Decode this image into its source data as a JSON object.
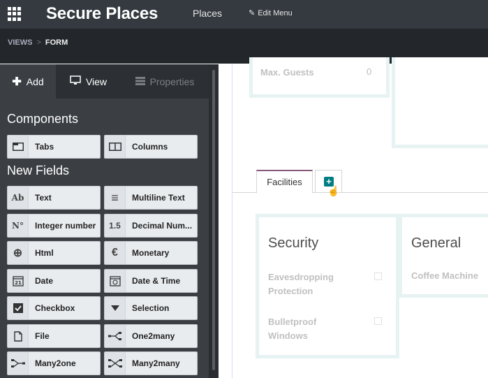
{
  "topbar": {
    "app_title": "Secure Places",
    "menu_places": "Places",
    "edit_menu": "Edit Menu"
  },
  "breadcrumb": {
    "views": "VIEWS",
    "sep": ">",
    "form": "FORM"
  },
  "sidebar": {
    "tabs": {
      "add": "Add",
      "view": "View",
      "properties": "Properties"
    },
    "components_title": "Components",
    "new_fields_title": "New Fields",
    "components": [
      {
        "label": "Tabs",
        "icon": "tabs-icon"
      },
      {
        "label": "Columns",
        "icon": "columns-icon"
      }
    ],
    "fields": [
      {
        "label": "Text",
        "glyph": "Ab"
      },
      {
        "label": "Multiline Text",
        "glyph": "≡"
      },
      {
        "label": "Integer number",
        "glyph": "N°"
      },
      {
        "label": "Decimal Num...",
        "glyph": "1.5"
      },
      {
        "label": "Html",
        "glyph": "⊕"
      },
      {
        "label": "Monetary",
        "glyph": "€"
      },
      {
        "label": "Date",
        "glyph": "21"
      },
      {
        "label": "Date & Time",
        "glyph": "◷"
      },
      {
        "label": "Checkbox",
        "glyph": "☑"
      },
      {
        "label": "Selection",
        "glyph": "▼"
      },
      {
        "label": "File",
        "glyph": "🗋"
      },
      {
        "label": "One2many",
        "glyph": "⋲"
      },
      {
        "label": "Many2one",
        "glyph": "⋺"
      },
      {
        "label": "Many2many",
        "glyph": "⤨"
      }
    ]
  },
  "form": {
    "max_guests_label": "Max. Guests",
    "max_guests_value": "0",
    "tab_facilities": "Facilities",
    "security_title": "Security",
    "general_title": "General",
    "eavesdropping": "Eavesdropping Protection",
    "bulletproof": "Bulletproof Windows",
    "coffee_machine": "Coffee Machine"
  }
}
